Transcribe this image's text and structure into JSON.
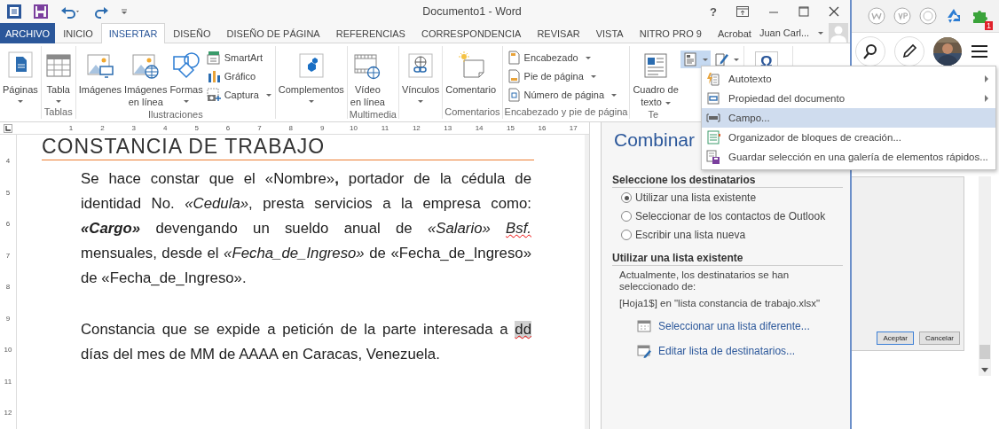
{
  "title_bar": {
    "title": "Documento1 - Word",
    "help": "?"
  },
  "tabs": [
    {
      "label": "ARCHIVO",
      "kind": "file",
      "selected": false
    },
    {
      "label": "INICIO",
      "kind": "tab",
      "selected": false
    },
    {
      "label": "INSERTAR",
      "kind": "tab",
      "selected": true
    },
    {
      "label": "DISEÑO",
      "kind": "tab",
      "selected": false
    },
    {
      "label": "DISEÑO DE PÁGINA",
      "kind": "tab",
      "selected": false
    },
    {
      "label": "REFERENCIAS",
      "kind": "tab",
      "selected": false
    },
    {
      "label": "CORRESPONDENCIA",
      "kind": "tab",
      "selected": false
    },
    {
      "label": "REVISAR",
      "kind": "tab",
      "selected": false
    },
    {
      "label": "VISTA",
      "kind": "tab",
      "selected": false
    },
    {
      "label": "NITRO PRO 9",
      "kind": "tab",
      "selected": false
    },
    {
      "label": "Acrobat",
      "kind": "tab",
      "selected": false
    }
  ],
  "account": {
    "name": "Juan Carl..."
  },
  "ribbon": {
    "groups": [
      {
        "items": [
          {
            "kind": "large",
            "lines": [
              "Páginas"
            ],
            "dropdown": true
          }
        ]
      },
      {
        "label": "Tablas",
        "items": [
          {
            "kind": "large",
            "lines": [
              "Tabla"
            ],
            "dropdown": true
          }
        ]
      },
      {
        "label": "Ilustraciones",
        "items": [
          {
            "kind": "large",
            "lines": [
              "Imágenes"
            ],
            "dropdown": false
          },
          {
            "kind": "large",
            "lines": [
              "Imágenes",
              "en línea"
            ],
            "dropdown": false
          },
          {
            "kind": "large",
            "lines": [
              "Formas"
            ],
            "dropdown": true
          },
          {
            "kind": "stack",
            "items": [
              {
                "label": "SmartArt",
                "dropdown": false
              },
              {
                "label": "Gráfico",
                "dropdown": false
              },
              {
                "label": "Captura",
                "dropdown": true
              }
            ]
          }
        ]
      },
      {
        "items": [
          {
            "kind": "large",
            "lines": [
              "Complementos"
            ],
            "dropdown": true
          }
        ]
      },
      {
        "label": "Multimedia",
        "items": [
          {
            "kind": "large",
            "lines": [
              "Vídeo",
              "en línea"
            ],
            "dropdown": false
          }
        ]
      },
      {
        "items": [
          {
            "kind": "large",
            "lines": [
              "Vínculos"
            ],
            "dropdown": true
          }
        ]
      },
      {
        "label": "Comentarios",
        "items": [
          {
            "kind": "large",
            "lines": [
              "Comentario"
            ],
            "dropdown": false
          }
        ]
      },
      {
        "label": "Encabezado y pie de página",
        "items": [
          {
            "kind": "stack",
            "items": [
              {
                "label": "Encabezado",
                "dropdown": true
              },
              {
                "label": "Pie de página",
                "dropdown": true
              },
              {
                "label": "Número de página",
                "dropdown": true
              }
            ]
          }
        ]
      },
      {
        "label": "Te",
        "items": [
          {
            "kind": "large",
            "lines": [
              "Cuadro de",
              "texto"
            ],
            "dropdown": true
          },
          {
            "kind": "icon",
            "pressed": true,
            "dropdown": true
          },
          {
            "kind": "icon",
            "pressed": false,
            "dropdown": true
          }
        ]
      },
      {
        "items": [
          {
            "kind": "symbol",
            "text": "Ω",
            "dropdown": false
          }
        ]
      }
    ]
  },
  "ruler": {
    "h_marks": [
      "1",
      "2",
      "3",
      "4",
      "5",
      "6",
      "7",
      "8",
      "9",
      "10",
      "11",
      "12",
      "13",
      "14",
      "15",
      "16",
      "17"
    ],
    "v_marks": [
      "4",
      "5",
      "6",
      "7",
      "8",
      "9",
      "10",
      "11",
      "12"
    ]
  },
  "document": {
    "heading": "CONSTANCIA DE TRABAJO",
    "paragraphs": [
      [
        {
          "text": "Se hace constar que el «Nombre»**,** portador de la cédula de identidad No. *«Cedula»*, presta servicios a la empresa como: ",
          "shaded": false,
          "misspelled": false,
          "emphasis": false
        },
        {
          "text": "«Cargo»",
          "shaded": false,
          "misspelled": false,
          "emphasis": true
        },
        {
          "text": " devengando un sueldo anual de *«Salario»* ",
          "shaded": false,
          "misspelled": false,
          "emphasis": false
        },
        {
          "text": "*Bsf.*",
          "shaded": false,
          "misspelled": true,
          "emphasis": false
        },
        {
          "text": " mensuales, desde el *«Fecha_de_Ingreso»* de «Fecha_de_Ingreso» de «Fecha_de_Ingreso».",
          "shaded": false,
          "misspelled": false,
          "emphasis": false
        }
      ],
      [
        {
          "text": "Constancia que se expide a petición de la parte interesada a ",
          "shaded": false,
          "misspelled": false,
          "emphasis": false
        },
        {
          "text": "dd",
          "shaded": true,
          "misspelled": true,
          "emphasis": false
        },
        {
          "text": " días del mes de MM de AAAA en Caracas, Venezuela.",
          "shaded": false,
          "misspelled": false,
          "emphasis": false
        }
      ]
    ]
  },
  "pane": {
    "title": "Combinar",
    "select_section": {
      "heading": "Seleccione los destinatarios",
      "options": [
        {
          "label": "Utilizar una lista existente",
          "selected": true
        },
        {
          "label": "Seleccionar de los contactos de Outlook",
          "selected": false
        },
        {
          "label": "Escribir una lista nueva",
          "selected": false
        }
      ]
    },
    "list_section": {
      "heading": "Utilizar una lista existente",
      "description": "Actualmente, los destinatarios se han seleccionado de:",
      "source": "[Hoja1$] en \"lista constancia de trabajo.xlsx\"",
      "links": [
        "Seleccionar una lista diferente...",
        "Editar lista de destinatarios..."
      ]
    }
  },
  "menu": {
    "items": [
      {
        "label": "Autotexto",
        "submenu": true,
        "selected": false
      },
      {
        "label": "Propiedad del documento",
        "submenu": true,
        "selected": false
      },
      {
        "label": "Campo...",
        "submenu": false,
        "selected": true
      },
      {
        "label": "Organizador de bloques de creación...",
        "submenu": false,
        "selected": false
      },
      {
        "label": "Guardar selección en una galería de elementos rápidos...",
        "submenu": false,
        "selected": false
      }
    ]
  },
  "browser": {
    "extension_badge": "1",
    "dialog_buttons": [
      {
        "label": "Aceptar",
        "focused": true
      },
      {
        "label": "Cancelar",
        "focused": false
      }
    ]
  }
}
